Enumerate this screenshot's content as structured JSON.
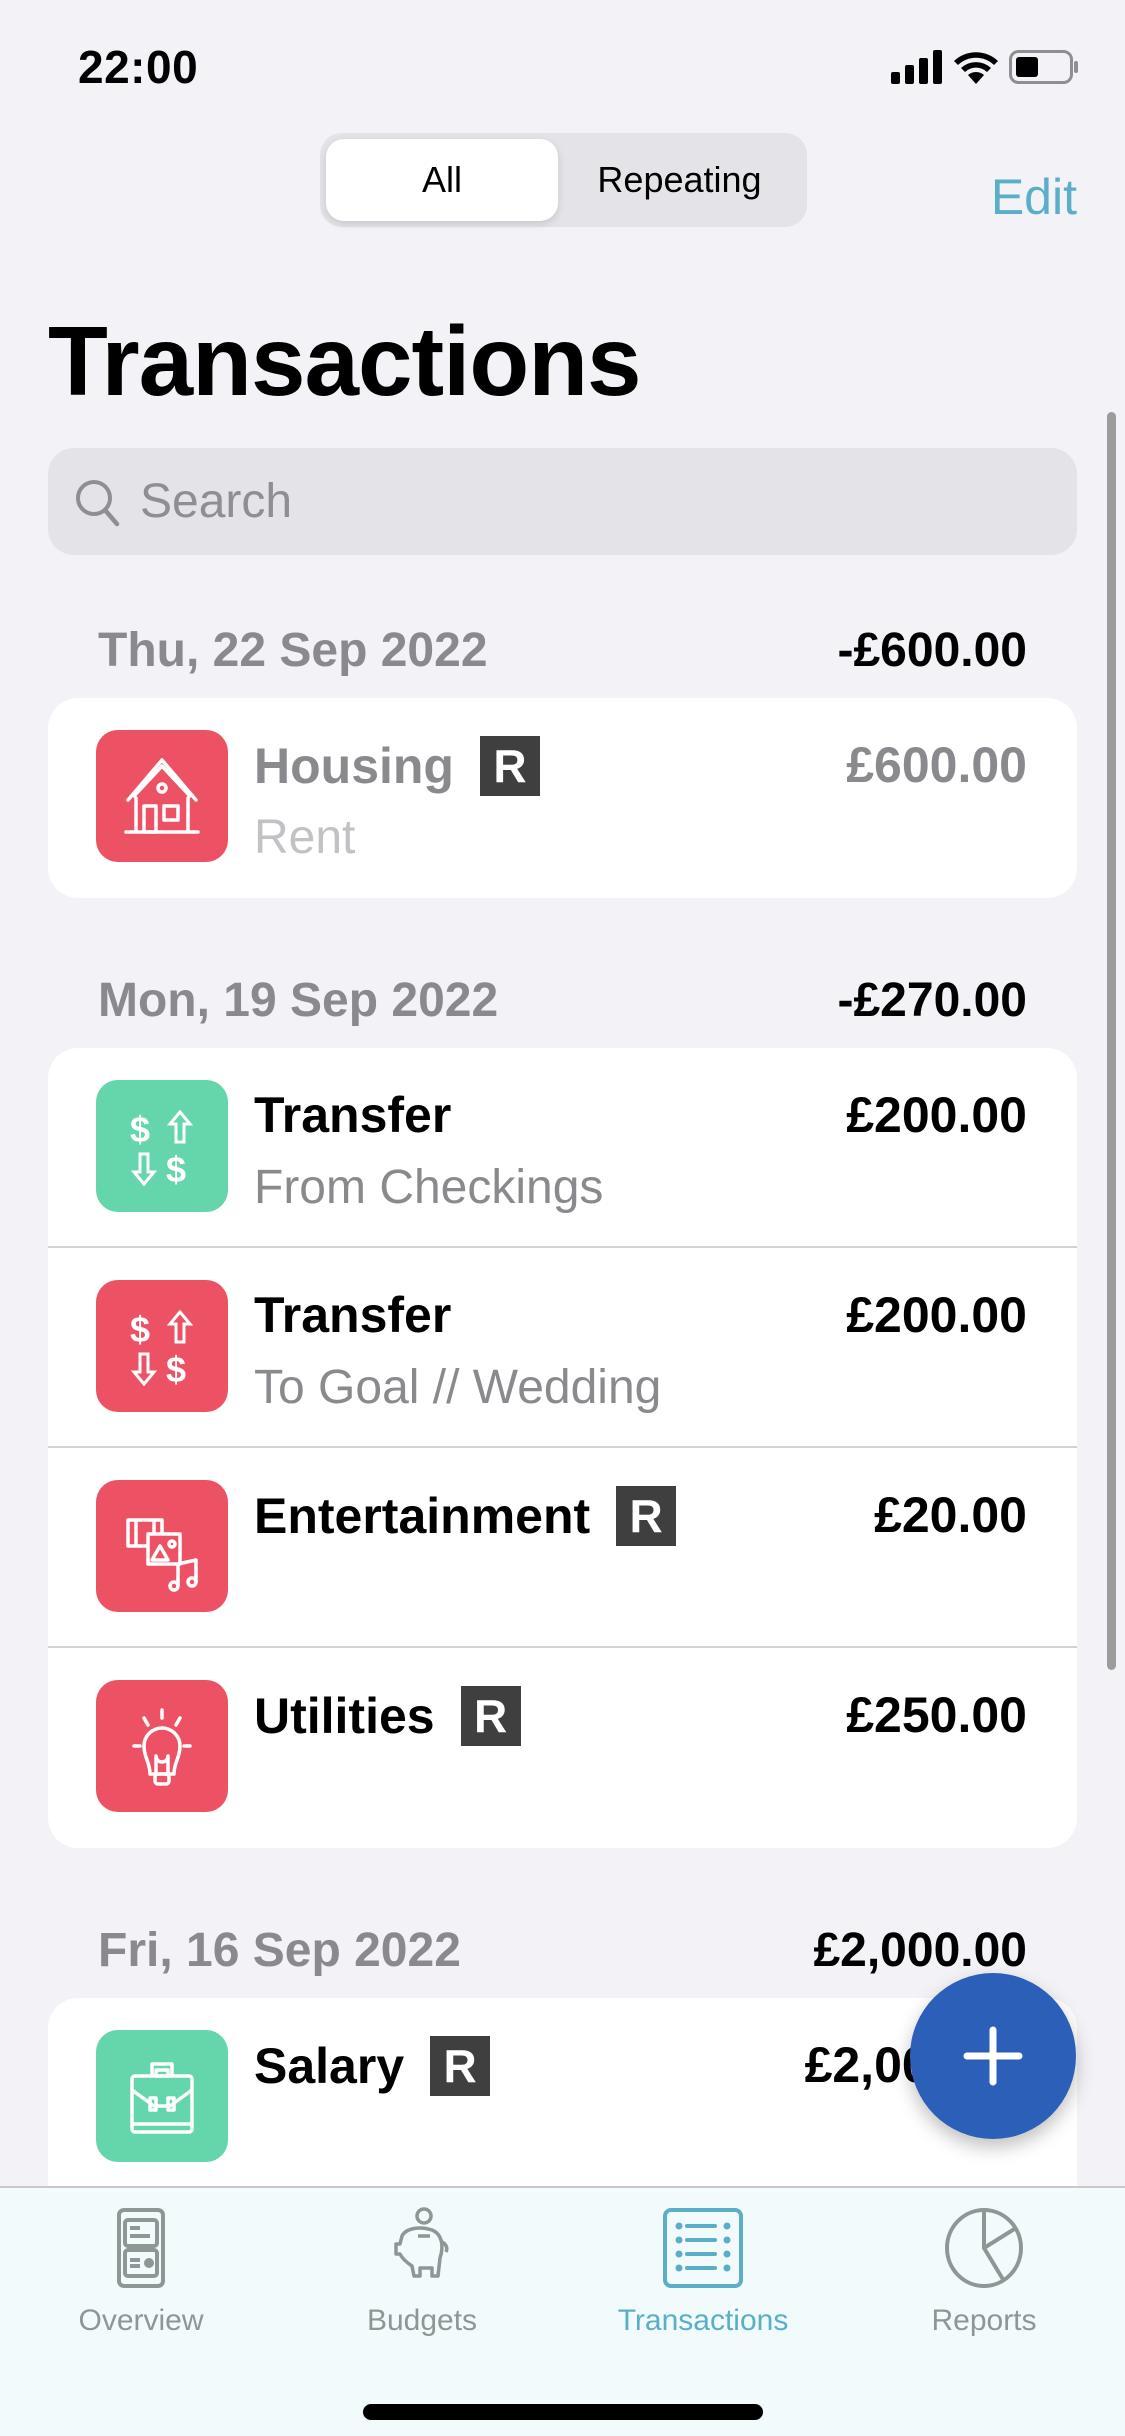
{
  "status_bar": {
    "time": "22:00",
    "icons": [
      "signal-icon",
      "wifi-icon",
      "battery-icon"
    ]
  },
  "nav": {
    "segments": [
      {
        "label": "All",
        "selected": true
      },
      {
        "label": "Repeating",
        "selected": false
      }
    ],
    "edit_label": "Edit"
  },
  "page_title": "Transactions",
  "search": {
    "placeholder": "Search",
    "value": ""
  },
  "sections": [
    {
      "date": "Thu, 22 Sep 2022",
      "total": "-£600.00",
      "items": [
        {
          "title": "Housing",
          "repeating": true,
          "subtitle": "Rent",
          "amount": "£600.00",
          "icon": "house-icon",
          "color": "#ec5264",
          "pending": true
        }
      ]
    },
    {
      "date": "Mon, 19 Sep 2022",
      "total": "-£270.00",
      "items": [
        {
          "title": "Transfer",
          "repeating": false,
          "subtitle": "From Checkings",
          "amount": "£200.00",
          "icon": "transfer-icon",
          "color": "#65d5ab"
        },
        {
          "title": "Transfer",
          "repeating": false,
          "subtitle": "To Goal // Wedding",
          "amount": "£200.00",
          "icon": "transfer-icon",
          "color": "#ec5264"
        },
        {
          "title": "Entertainment",
          "repeating": true,
          "subtitle": "",
          "amount": "£20.00",
          "icon": "media-icon",
          "color": "#ec5264"
        },
        {
          "title": "Utilities",
          "repeating": true,
          "subtitle": "",
          "amount": "£250.00",
          "icon": "lightbulb-icon",
          "color": "#ec5264"
        }
      ]
    },
    {
      "date": "Fri, 16 Sep 2022",
      "total": "£2,000.00",
      "items": [
        {
          "title": "Salary",
          "repeating": true,
          "subtitle": "",
          "amount": "£2,000.00",
          "icon": "briefcase-icon",
          "color": "#65d5ab"
        }
      ]
    }
  ],
  "badge_label": "R",
  "fab": {
    "icon": "plus-icon"
  },
  "tab_bar": {
    "tabs": [
      {
        "label": "Overview",
        "icon": "overview-icon",
        "active": false
      },
      {
        "label": "Budgets",
        "icon": "piggy-bank-icon",
        "active": false
      },
      {
        "label": "Transactions",
        "icon": "list-icon",
        "active": true
      },
      {
        "label": "Reports",
        "icon": "pie-chart-icon",
        "active": false
      }
    ]
  },
  "colors": {
    "accent": "#5aaec8",
    "expense": "#ec5264",
    "income": "#65d5ab",
    "fab": "#2b5fb8",
    "background": "#f2f2f7"
  }
}
